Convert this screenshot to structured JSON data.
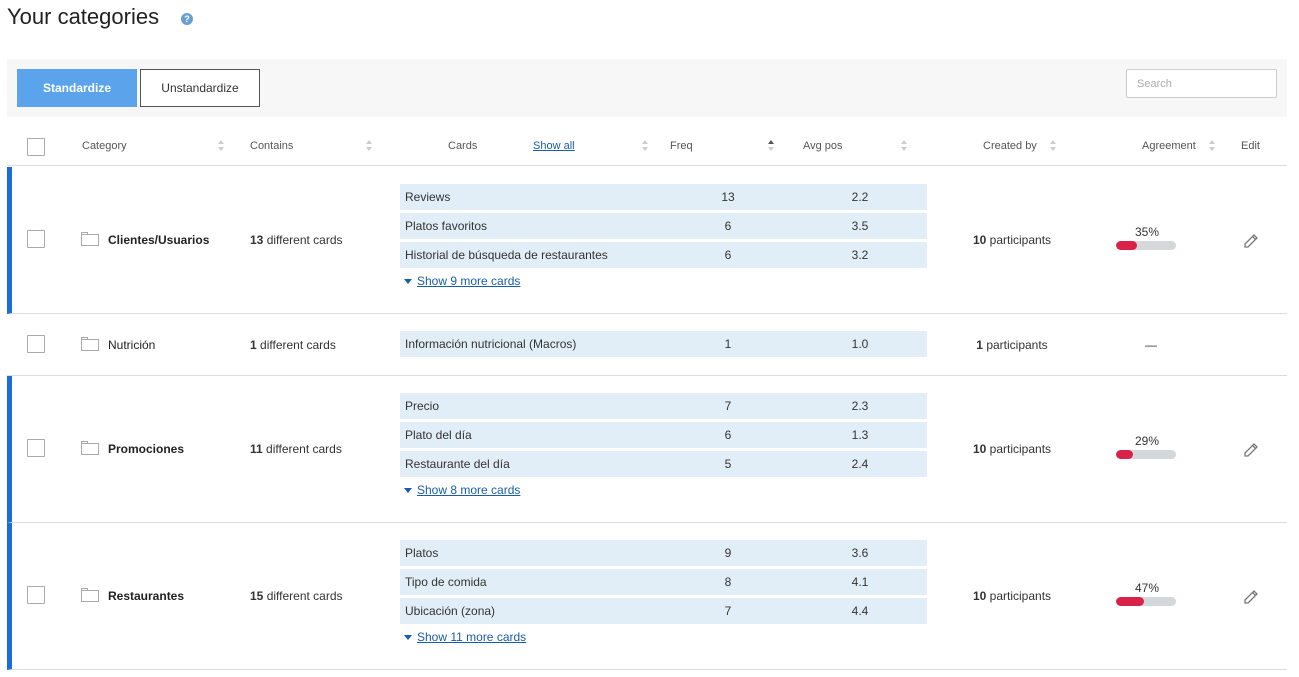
{
  "title": "Your categories",
  "help_icon": "?",
  "toolbar": {
    "standardize_label": "Standardize",
    "unstandardize_label": "Unstandardize",
    "search_placeholder": "Search",
    "primary_color": "#5ba4ec"
  },
  "columns": {
    "category": "Category",
    "contains": "Contains",
    "cards": "Cards",
    "show_all": "Show all",
    "freq": "Freq",
    "avg_pos": "Avg pos",
    "created_by": "Created by",
    "agreement": "Agreement",
    "edit": "Edit"
  },
  "rows": [
    {
      "name": "Clientes/Usuarios",
      "contains_count": "13",
      "contains_text": " different cards",
      "cards": [
        {
          "name": "Reviews",
          "freq": "13",
          "avg": "2.2"
        },
        {
          "name": "Platos favoritos",
          "freq": "6",
          "avg": "3.5"
        },
        {
          "name": "Historial de búsqueda de restaurantes",
          "freq": "6",
          "avg": "3.2"
        }
      ],
      "show_more": "Show 9 more cards",
      "created_count": "10",
      "created_text": " participants",
      "agreement_label": "35%",
      "agreement_value": 0.35
    },
    {
      "name": "Nutrición",
      "contains_count": "1",
      "contains_text": " different cards",
      "cards": [
        {
          "name": "Información nutricional (Macros)",
          "freq": "1",
          "avg": "1.0"
        }
      ],
      "created_count": "1",
      "created_text": " participants",
      "agreement_label": "—"
    },
    {
      "name": "Promociones",
      "contains_count": "11",
      "contains_text": " different cards",
      "cards": [
        {
          "name": "Precio",
          "freq": "7",
          "avg": "2.3"
        },
        {
          "name": "Plato del día",
          "freq": "6",
          "avg": "1.3"
        },
        {
          "name": "Restaurante del día",
          "freq": "5",
          "avg": "2.4"
        }
      ],
      "show_more": "Show 8 more cards",
      "created_count": "10",
      "created_text": " participants",
      "agreement_label": "29%",
      "agreement_value": 0.29
    },
    {
      "name": "Restaurantes",
      "contains_count": "15",
      "contains_text": " different cards",
      "cards": [
        {
          "name": "Platos",
          "freq": "9",
          "avg": "3.6"
        },
        {
          "name": "Tipo de comida",
          "freq": "8",
          "avg": "4.1"
        },
        {
          "name": "Ubicación (zona)",
          "freq": "7",
          "avg": "4.4"
        }
      ],
      "show_more": "Show 11 more cards",
      "created_count": "10",
      "created_text": " participants",
      "agreement_label": "47%",
      "agreement_value": 0.47
    }
  ],
  "colors": {
    "row_marker": "#1a6fd6",
    "card_bg": "#e2eef7",
    "agreement_fill": "#d8224a",
    "agreement_track": "#d4d8db",
    "link": "#1a5da8"
  }
}
